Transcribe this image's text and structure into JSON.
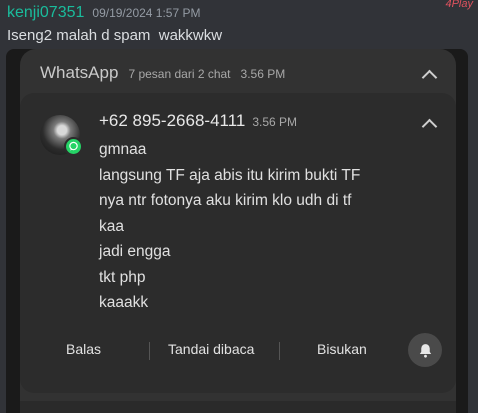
{
  "post": {
    "username": "kenji07351",
    "timestamp": "09/19/2024 1:57 PM",
    "message": "Iseng2 malah d spam  wakkwkw",
    "watermark": "4Play"
  },
  "notification": {
    "app_name": "WhatsApp",
    "app_info": "7 pesan dari 2 chat",
    "app_time": "3.56 PM",
    "sender": "+62 895-2668-4111",
    "sender_time": "3.56 PM",
    "messages": [
      "gmnaa",
      "langsung TF aja abis itu kirim bukti TF",
      "nya ntr fotonya aku kirim klo udh di tf",
      "kaa",
      "jadi engga",
      "tkt php",
      "kaaakk"
    ],
    "actions": {
      "reply": "Balas",
      "mark_read": "Tandai dibaca",
      "mute": "Bisukan"
    },
    "icons": [
      "chevron-up-icon",
      "whatsapp-icon",
      "bell-icon"
    ],
    "colors": {
      "username": "#1abc9c",
      "whatsapp_badge": "#25d366",
      "watermark": "#e0525e"
    }
  }
}
